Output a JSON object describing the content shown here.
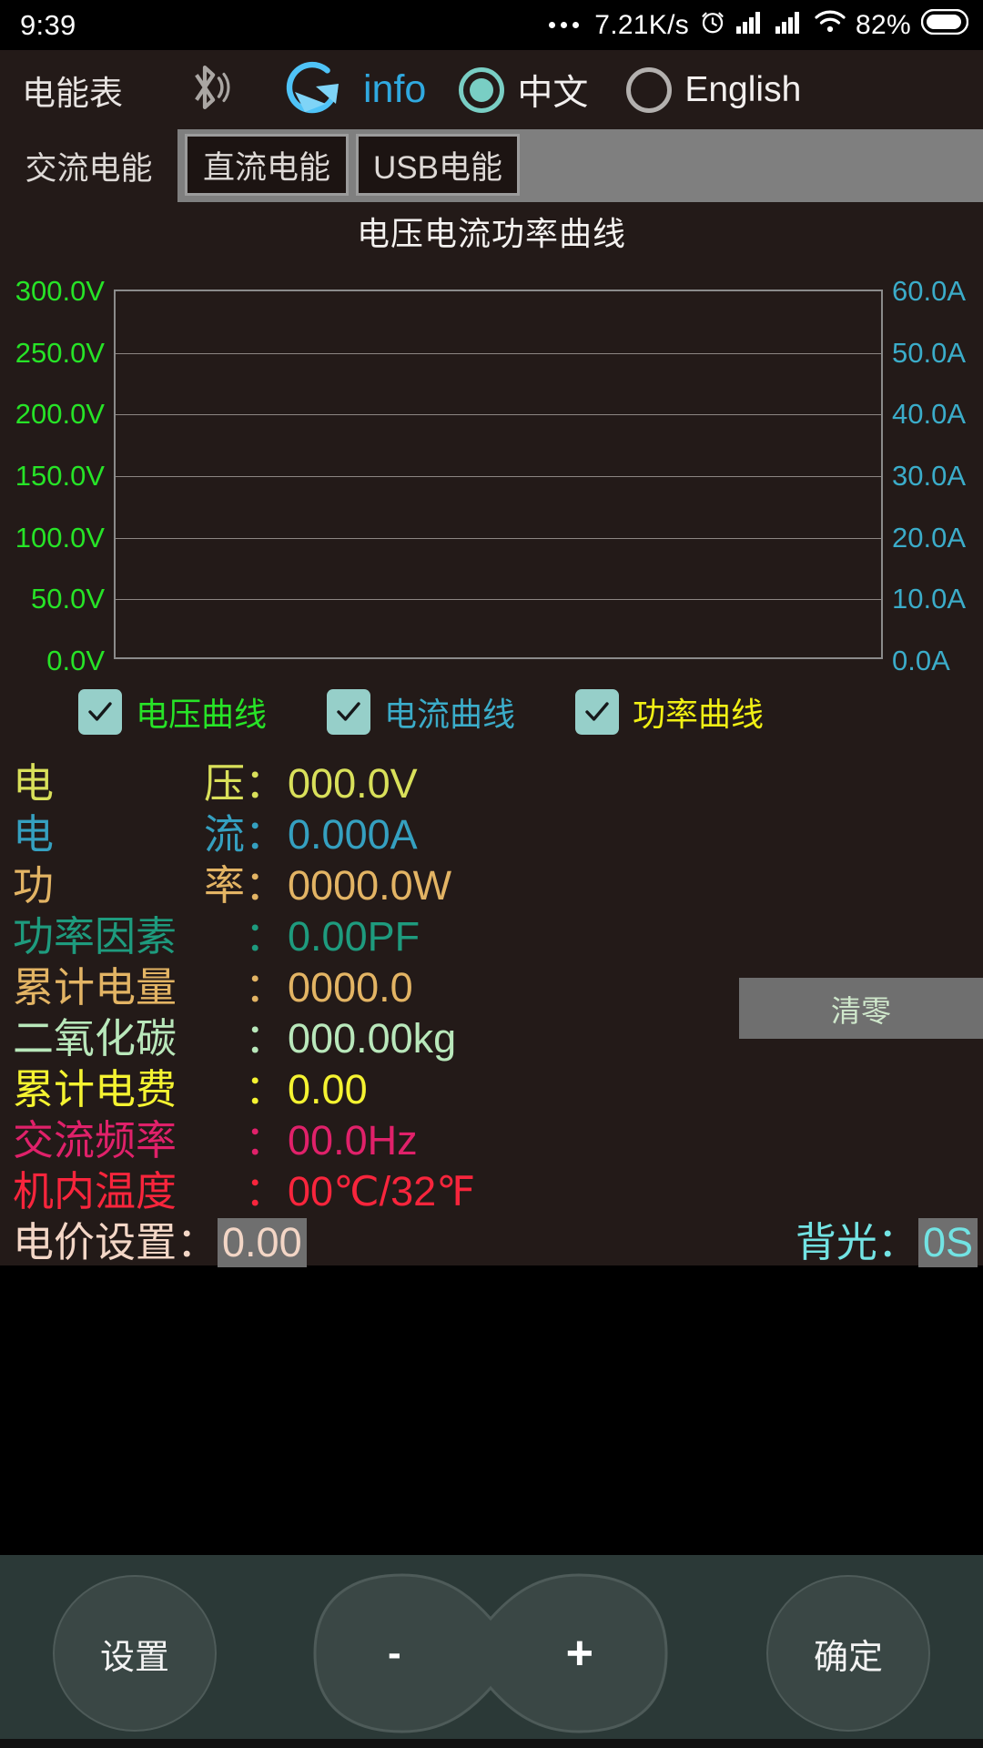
{
  "status_bar": {
    "clock": "9:39",
    "net_speed": "7.21K/s",
    "battery_percent": "82%",
    "icons": [
      "more-dots-icon",
      "alarm-clock-icon",
      "signal-bars-icon",
      "signal-bars-icon",
      "wifi-icon",
      "battery-icon"
    ]
  },
  "app_header": {
    "title": "电能表",
    "bluetooth_icon": "bluetooth-icon",
    "refresh_icon": "refresh-icon",
    "info_label": "info",
    "language": {
      "chinese_label": "中文",
      "english_label": "English",
      "selected": "中文",
      "accent": "#79cec4",
      "inactive": "#b3b0ae"
    }
  },
  "tabs": [
    {
      "label": "交流电能",
      "selected": true
    },
    {
      "label": "直流电能",
      "selected": false
    },
    {
      "label": "USB电能",
      "selected": false
    }
  ],
  "chart_data": {
    "type": "line",
    "title": "电压电流功率曲线",
    "xlabel": "",
    "ylabel": "",
    "grid": true,
    "legend_position": "bottom",
    "series": [
      {
        "name": "电压曲线",
        "color": "#27e327",
        "values": [],
        "visible": true
      },
      {
        "name": "电流曲线",
        "color": "#3bacc9",
        "values": [],
        "visible": true
      },
      {
        "name": "功率曲线",
        "color": "#f0ef14",
        "values": [],
        "visible": true
      }
    ],
    "left_axis": {
      "unit": "V",
      "color": "#27e327",
      "ylim": [
        0,
        300
      ],
      "ticks": [
        "300.0V",
        "250.0V",
        "200.0V",
        "150.0V",
        "100.0V",
        "50.0V",
        "0.0V"
      ],
      "tick_values": [
        300,
        250,
        200,
        150,
        100,
        50,
        0
      ]
    },
    "right_axis": {
      "unit": "A",
      "color": "#3bacc9",
      "ylim": [
        0,
        60
      ],
      "ticks": [
        "60.0A",
        "50.0A",
        "40.0A",
        "30.0A",
        "20.0A",
        "10.0A",
        "0.0A"
      ],
      "tick_values": [
        60,
        50,
        40,
        30,
        20,
        10,
        0
      ]
    }
  },
  "legend": [
    {
      "label": "电压曲线",
      "color": "#27e327",
      "checked": true
    },
    {
      "label": "电流曲线",
      "color": "#3bacc9",
      "checked": true
    },
    {
      "label": "功率曲线",
      "color": "#f0ef14",
      "checked": true
    }
  ],
  "readouts": [
    {
      "label_a": "电",
      "label_b": "压",
      "colon": "：",
      "value": "000.0V",
      "color": "#d9e05a"
    },
    {
      "label_a": "电",
      "label_b": "流",
      "colon": "：",
      "value": "0.000A",
      "color": "#35a0c0"
    },
    {
      "label_a": "功",
      "label_b": "率",
      "colon": "：",
      "value": "0000.0W",
      "color": "#e3b464"
    },
    {
      "label": "功率因素",
      "colon": "：",
      "value": "0.00PF",
      "color": "#1e9b7e"
    },
    {
      "label": "累计电量",
      "colon": "：",
      "value": "0000.0",
      "color": "#e3b464"
    },
    {
      "label": "二氧化碳",
      "colon": "：",
      "value": "000.00kg",
      "color": "#b9e8bb"
    },
    {
      "label": "累计电费",
      "colon": "：",
      "value": "0.00",
      "color": "#f5f331"
    },
    {
      "label": "交流频率",
      "colon": "：",
      "value": "00.0Hz",
      "color": "#e0216a"
    },
    {
      "label": "机内温度",
      "colon": "：",
      "value": "00℃/32℉",
      "color": "#f8253c"
    }
  ],
  "clear_button": {
    "label": "清零",
    "bg": "#6f6f6f",
    "color": "#cfe7cb"
  },
  "price_row": {
    "label": "电价设置",
    "colon": "：",
    "value": "0.00",
    "color": "#f3d6c6",
    "backlight_label": "背光",
    "backlight_colon": "：",
    "backlight_value": "0S",
    "backlight_color": "#72e3e3",
    "highlight_bg": "#6f6f6f"
  },
  "bottom_bar": {
    "settings_label": "设置",
    "minus_label": "-",
    "plus_label": "+",
    "confirm_label": "确定",
    "bg": "#2b3937"
  }
}
